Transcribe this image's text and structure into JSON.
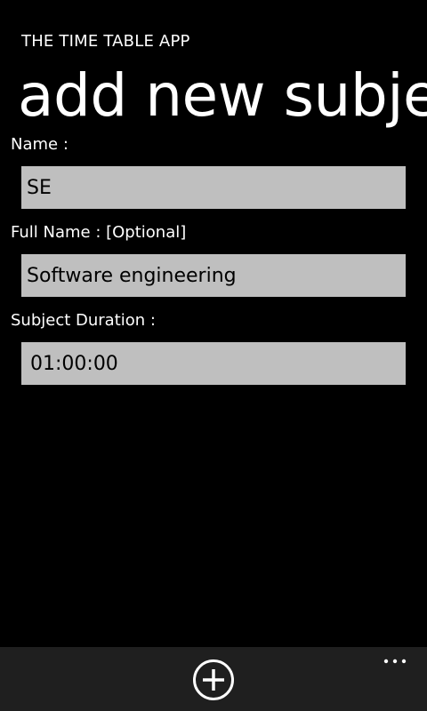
{
  "header": {
    "app_name": "THE TIME TABLE APP",
    "page_title": "add new subject"
  },
  "form": {
    "name": {
      "label": "Name :",
      "value": "SE"
    },
    "full_name": {
      "label": "Full Name : [Optional]",
      "value": "Software engineering"
    },
    "duration": {
      "label": "Subject Duration :",
      "value": "01:00:00"
    }
  },
  "app_bar": {
    "add_icon": "plus-circle-icon",
    "more_icon": "ellipsis-icon",
    "background": "#1f1f1f"
  },
  "colors": {
    "background": "#000000",
    "field_background": "#bfbfbf",
    "text": "#ffffff",
    "field_text": "#000000"
  }
}
